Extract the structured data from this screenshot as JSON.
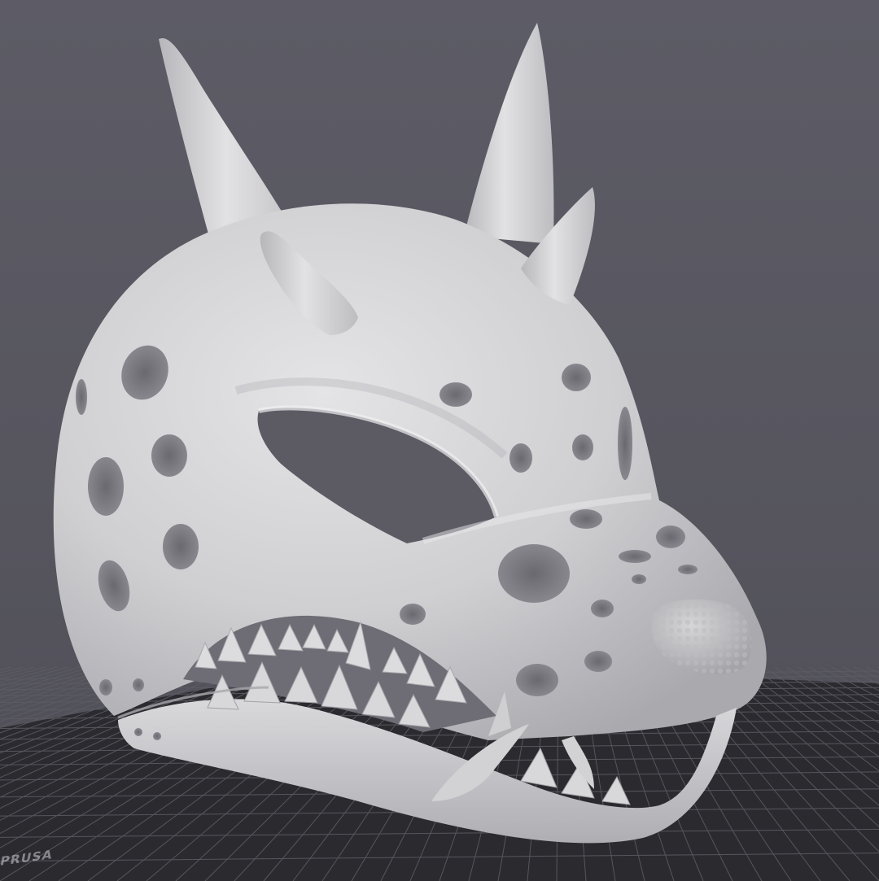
{
  "app": {
    "view": "3d-viewport",
    "background_color": "#5a5962",
    "bed_color": "#2b2b2f",
    "bed_grid_color": "#5d5d66",
    "model_color": "#cfcfd2"
  },
  "build_plate": {
    "label": "PRUSA"
  },
  "model": {
    "icon": "dragon-mask-model"
  }
}
